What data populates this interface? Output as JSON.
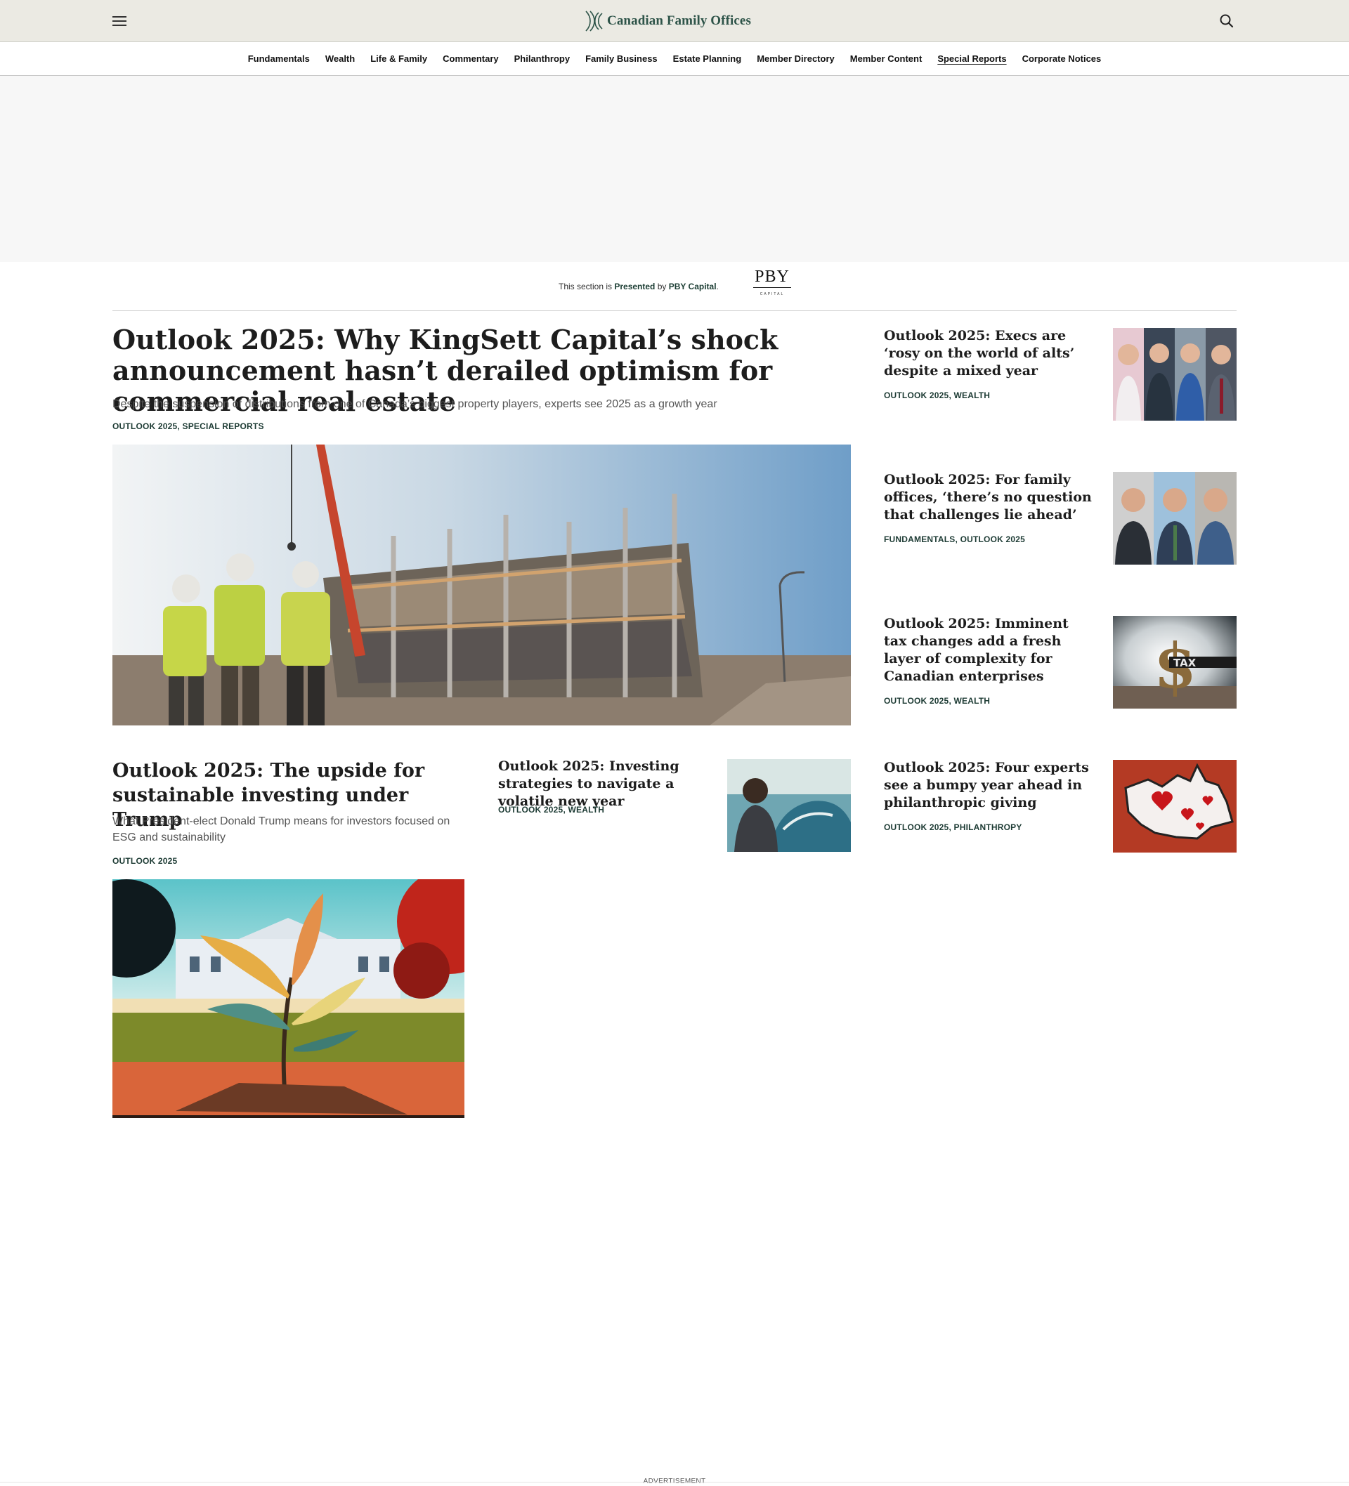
{
  "site": {
    "name": "Canadian Family Offices",
    "brand_color": "#2e5449",
    "menu_icon": "hamburger-menu-icon",
    "search_icon": "magnifier-search-icon"
  },
  "nav": {
    "items": [
      "Fundamentals",
      "Wealth",
      "Life & Family",
      "Commentary",
      "Philanthropy",
      "Family Business",
      "Estate Planning",
      "Member Directory",
      "Member Content",
      "Special Reports",
      "Corporate Notices"
    ],
    "active": "Special Reports"
  },
  "sponsor": {
    "prefix": "This section is ",
    "presented": "Presented",
    "by": " by ",
    "name": "PBY Capital",
    "suffix": ".",
    "logo_word": "PBY",
    "logo_sub": "CAPITAL"
  },
  "lead": {
    "title": "Outlook 2025: Why KingSett Capital’s shock announcement hasn’t derailed optimism for commercial real estate",
    "dek": "Despite the suspension of distributions from one of Canada’s biggest property players, experts see 2025 as a growth year",
    "tag1": "OUTLOOK 2025",
    "tag2": "SPECIAL REPORTS"
  },
  "second": {
    "title": "Outlook 2025: The upside for sustainable investing under Trump",
    "dek": "What President-elect Donald Trump means for investors focused on ESG and sustainability",
    "tag1": "OUTLOOK 2025"
  },
  "mid": {
    "title": "Outlook 2025: Investing strategies to navigate a volatile new year",
    "tag1": "OUTLOOK 2025",
    "tag2": "WEALTH"
  },
  "side": [
    {
      "title": "Outlook 2025: Execs are ‘rosy on the world of alts’ despite a mixed year",
      "tag1": "OUTLOOK 2025",
      "tag2": "WEALTH"
    },
    {
      "title": "Outlook 2025: For family offices, ‘there’s no question that challenges lie ahead’",
      "tag1": "FUNDAMENTALS",
      "tag2": "OUTLOOK 2025"
    },
    {
      "title": "Outlook 2025: Imminent tax changes add a fresh layer of complexity for Canadian enterprises",
      "tag1": "OUTLOOK 2025",
      "tag2": "WEALTH"
    },
    {
      "title": "Outlook 2025: Four experts see a bumpy year ahead in philanthropic giving",
      "tag1": "OUTLOOK 2025",
      "tag2": "PHILANTHROPY"
    }
  ],
  "tax_word": "TAX",
  "ad_label": "ADVERTISEMENT"
}
